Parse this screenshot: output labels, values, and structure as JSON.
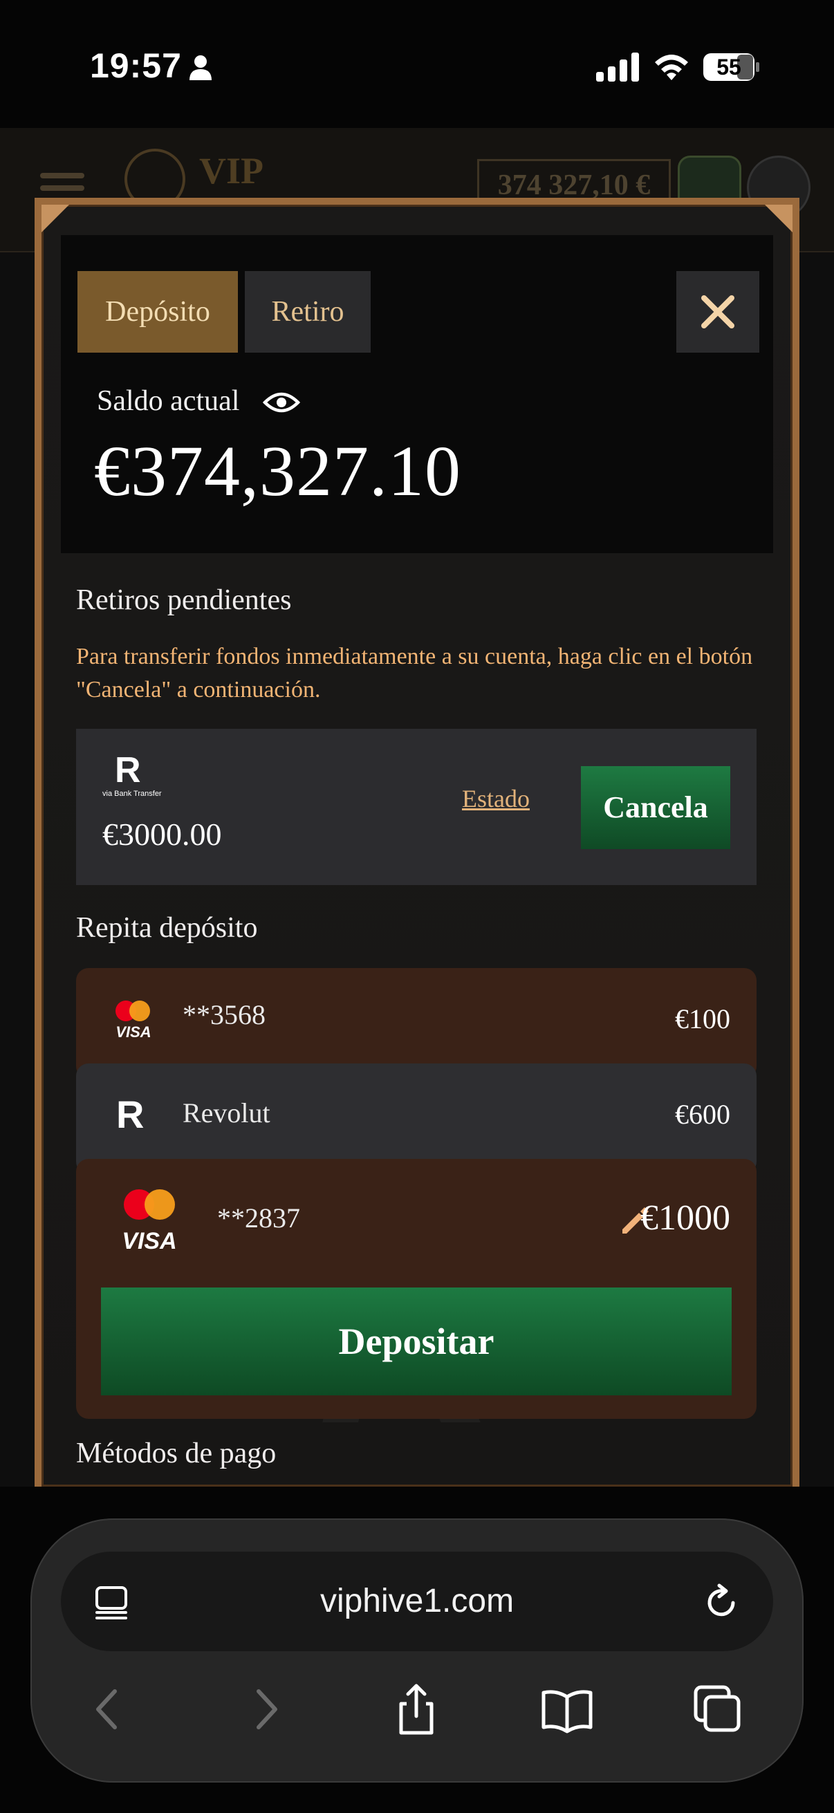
{
  "status_bar": {
    "time": "19:57",
    "battery": "55"
  },
  "site": {
    "logo_text": "VIP",
    "header_balance": "374 327,10 €"
  },
  "modal": {
    "tabs": [
      {
        "label": "Depósito",
        "active": true
      },
      {
        "label": "Retiro",
        "active": false
      }
    ],
    "balance_label": "Saldo actual",
    "balance_value": "€374,327.10",
    "pending": {
      "title": "Retiros pendientes",
      "note": "Para transferir fondos inmediatamente a su cuenta, haga clic en el botón \"Cancela\" a continuación.",
      "item": {
        "method_caption": "via Bank Transfer",
        "amount": "€3000.00",
        "status_link": "Estado",
        "cancel_label": "Cancela"
      }
    },
    "repeat": {
      "title": "Repita depósito",
      "items": [
        {
          "icon": "mastercard-visa-icon",
          "label": "**3568",
          "amount": "€100"
        },
        {
          "icon": "revolut-icon",
          "label": "Revolut",
          "amount": "€600"
        },
        {
          "icon": "mastercard-visa-icon",
          "label": "**2837",
          "amount": "€1000",
          "selected": true
        }
      ],
      "deposit_label": "Depositar"
    },
    "payment_methods_title": "Métodos de pago"
  },
  "browser": {
    "url": "viphive1.com"
  },
  "colors": {
    "accent_gold": "#7a5a2c",
    "frame_bronze": "#9b6a3c",
    "button_green": "#1d7a42",
    "note_orange": "#f2b474"
  }
}
